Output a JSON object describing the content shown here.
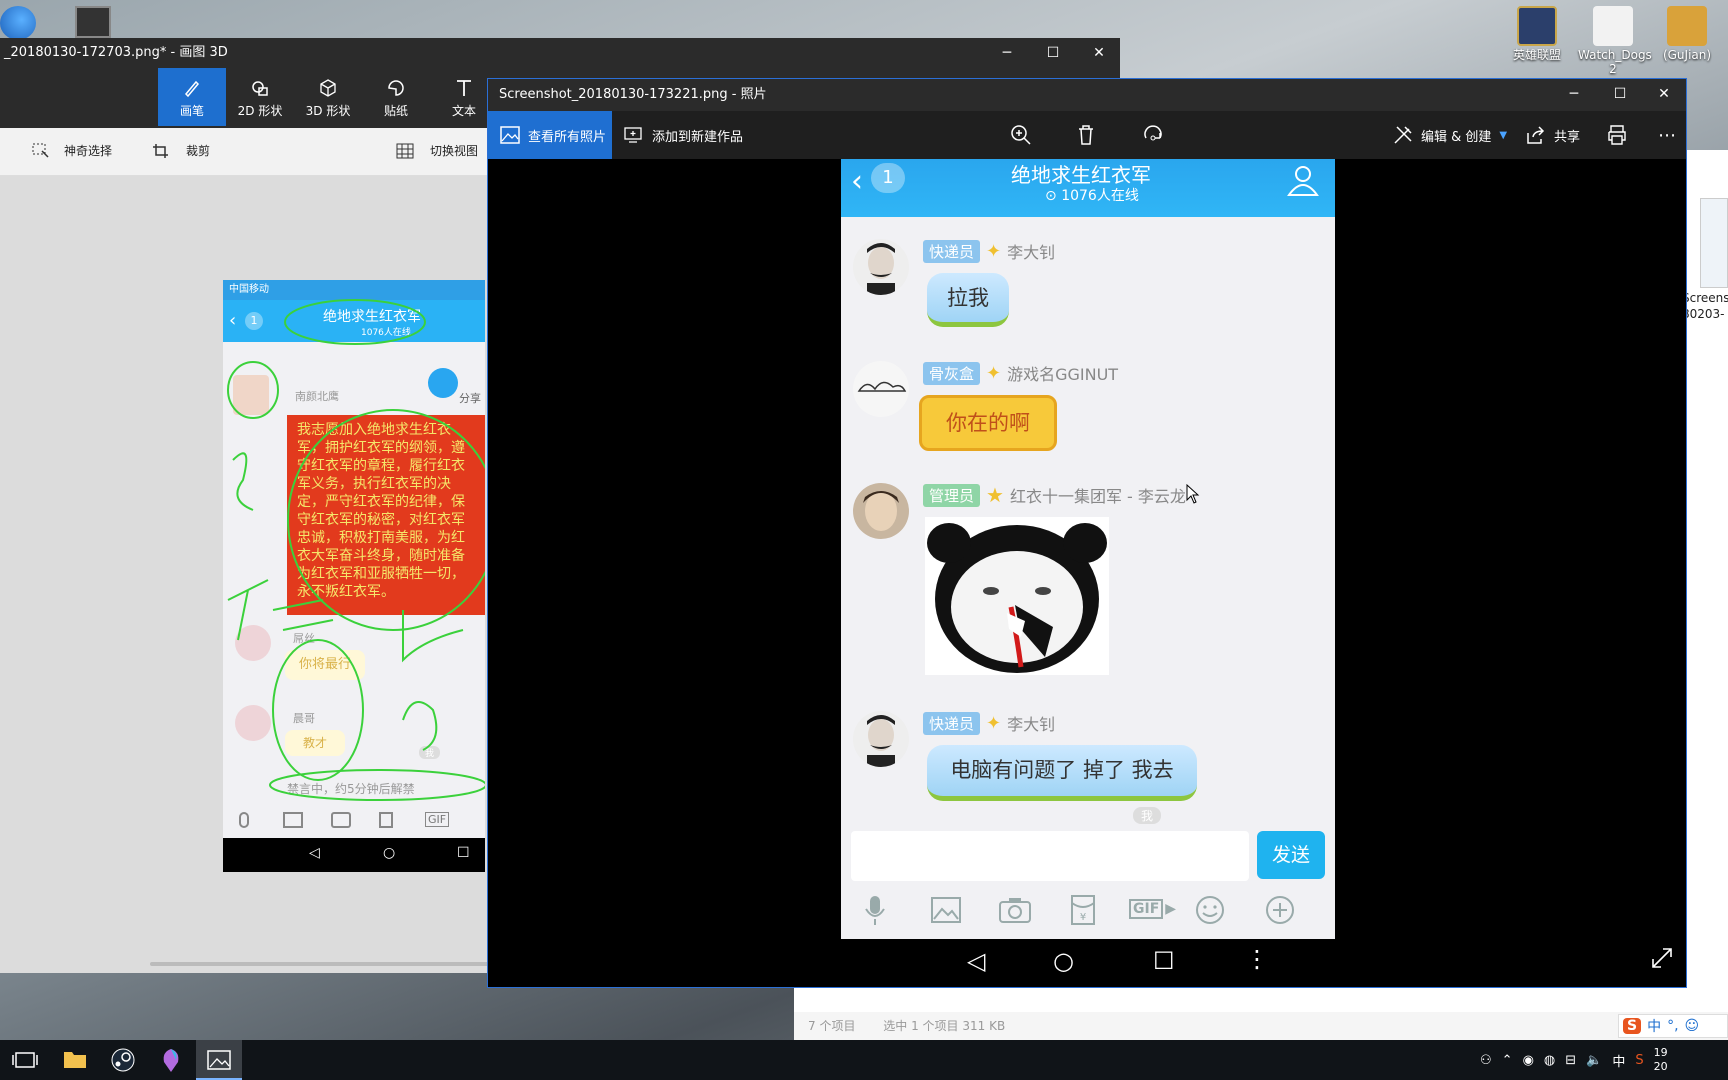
{
  "desktop": {
    "icons": [
      {
        "label": "英雄联盟",
        "icon": "league-of-legends-icon",
        "color": "#c9a64a"
      },
      {
        "label": "Watch_Dogs 2",
        "icon": "watch-dogs-icon",
        "color": "#e8e8e8"
      },
      {
        "label": "(GuJian)",
        "icon": "gujian-icon",
        "color": "#d9a23a"
      }
    ],
    "right_window": {
      "thumb_label": "Screens 80203-",
      "status_items": "7 个项目",
      "status_selected": "选中 1 个项目  311 KB"
    }
  },
  "paint3d": {
    "title": "_20180130-172703.png* - 画图 3D",
    "tabs": [
      {
        "label": "画笔",
        "icon": "brush-icon",
        "active": true
      },
      {
        "label": "2D 形状",
        "icon": "2d-shapes-icon",
        "active": false
      },
      {
        "label": "3D 形状",
        "icon": "3d-shapes-icon",
        "active": false
      },
      {
        "label": "贴纸",
        "icon": "stickers-icon",
        "active": false
      },
      {
        "label": "文本",
        "icon": "text-icon",
        "active": false
      }
    ],
    "subtools": {
      "magic_select": "神奇选择",
      "crop": "裁剪",
      "switch_view": "切换视图"
    },
    "phone": {
      "status": "中国移动",
      "back_count": "1",
      "group_name": "绝地求生红衣军",
      "online": "1076人在线",
      "share": "分享",
      "msg1_name": "南颜北鹰",
      "msg1_text": "我志愿加入绝地求生红衣军，拥护红衣军的纲领，遵守红衣军的章程，履行红衣军义务，执行红衣军的决定，严守红衣军的纪律，保守红衣军的秘密，对红衣军忠诚，积极打南美服，为红衣大军奋斗终身，随时准备为红衣军和亚服牺牲一切，永不叛红衣军。",
      "msg2_name": "屌丝",
      "msg2_text": "你将最行",
      "msg3_name": "晨哥",
      "msg3_text": "教才",
      "me": "我",
      "muted": "禁言中，约5分钟后解禁",
      "gif": "GIF"
    }
  },
  "photos": {
    "title": "Screenshot_20180130-173221.png - 照片",
    "cmd": {
      "view_all": "查看所有照片",
      "add_new": "添加到新建作品",
      "edit_create": "编辑 & 创建",
      "share": "共享"
    },
    "phone": {
      "back_count": "1",
      "group_name": "绝地求生红衣军",
      "online": "1076人在线",
      "messages": [
        {
          "badge": "快递员",
          "name": "李大钊",
          "text": "拉我"
        },
        {
          "badge": "骨灰盒",
          "name": "游戏名GGINUT",
          "text": "你在的啊"
        },
        {
          "badge": "管理员",
          "name": "红衣十一集团军 - 李云龙",
          "text": ""
        },
        {
          "badge": "快递员",
          "name": "李大钊",
          "text": "电脑有问题了 掉了 我去"
        }
      ],
      "me": "我",
      "send": "发送",
      "gif": "GIF"
    }
  },
  "taskbar": {
    "ime": "中",
    "clock_time": "19",
    "clock_year": "20",
    "lang": "中"
  },
  "colors": {
    "accent": "#1e6fcf",
    "qq_blue": "#30b6f6",
    "send": "#1fb3ef"
  }
}
